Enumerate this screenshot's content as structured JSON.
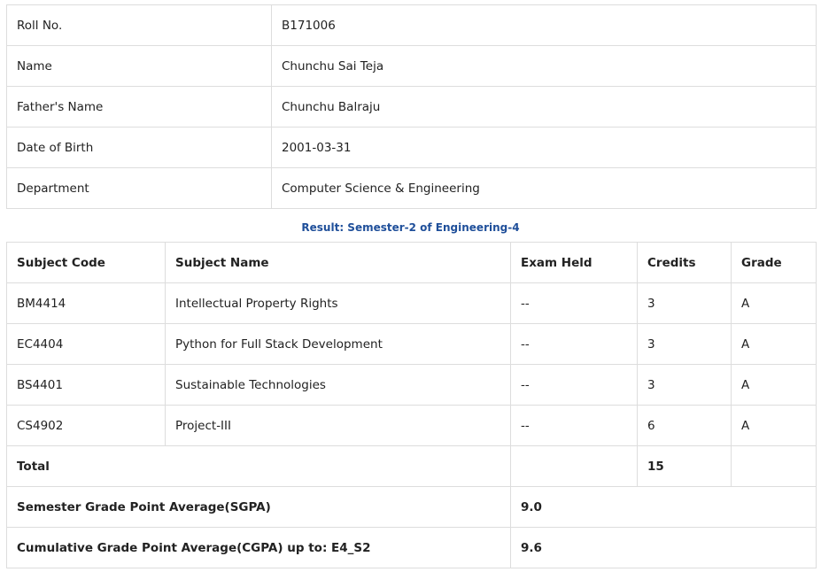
{
  "student": {
    "rows": [
      {
        "label": "Roll No.",
        "value": "B171006"
      },
      {
        "label": "Name",
        "value": "Chunchu Sai Teja"
      },
      {
        "label": "Father's Name",
        "value": "Chunchu Balraju"
      },
      {
        "label": "Date of Birth",
        "value": "2001-03-31"
      },
      {
        "label": "Department",
        "value": "Computer Science & Engineering"
      }
    ]
  },
  "result": {
    "caption": "Result: Semester-2 of Engineering-4",
    "headers": {
      "code": "Subject Code",
      "name": "Subject Name",
      "exam": "Exam Held",
      "credits": "Credits",
      "grade": "Grade"
    },
    "subjects": [
      {
        "code": "BM4414",
        "name": "Intellectual Property Rights",
        "exam": "--",
        "credits": "3",
        "grade": "A"
      },
      {
        "code": "EC4404",
        "name": "Python for Full Stack Development",
        "exam": "--",
        "credits": "3",
        "grade": "A"
      },
      {
        "code": "BS4401",
        "name": "Sustainable Technologies",
        "exam": "--",
        "credits": "3",
        "grade": "A"
      },
      {
        "code": "CS4902",
        "name": "Project-III",
        "exam": "--",
        "credits": "6",
        "grade": "A"
      }
    ],
    "total": {
      "label": "Total",
      "credits": "15"
    },
    "sgpa": {
      "label": "Semester Grade Point Average(SGPA)",
      "value": "9.0"
    },
    "cgpa": {
      "label": "Cumulative Grade Point Average(CGPA) up to: E4_S2",
      "value": "9.6"
    }
  },
  "colors": {
    "border": "#dddddd",
    "caption": "#1f4f9a",
    "text": "#222222"
  }
}
